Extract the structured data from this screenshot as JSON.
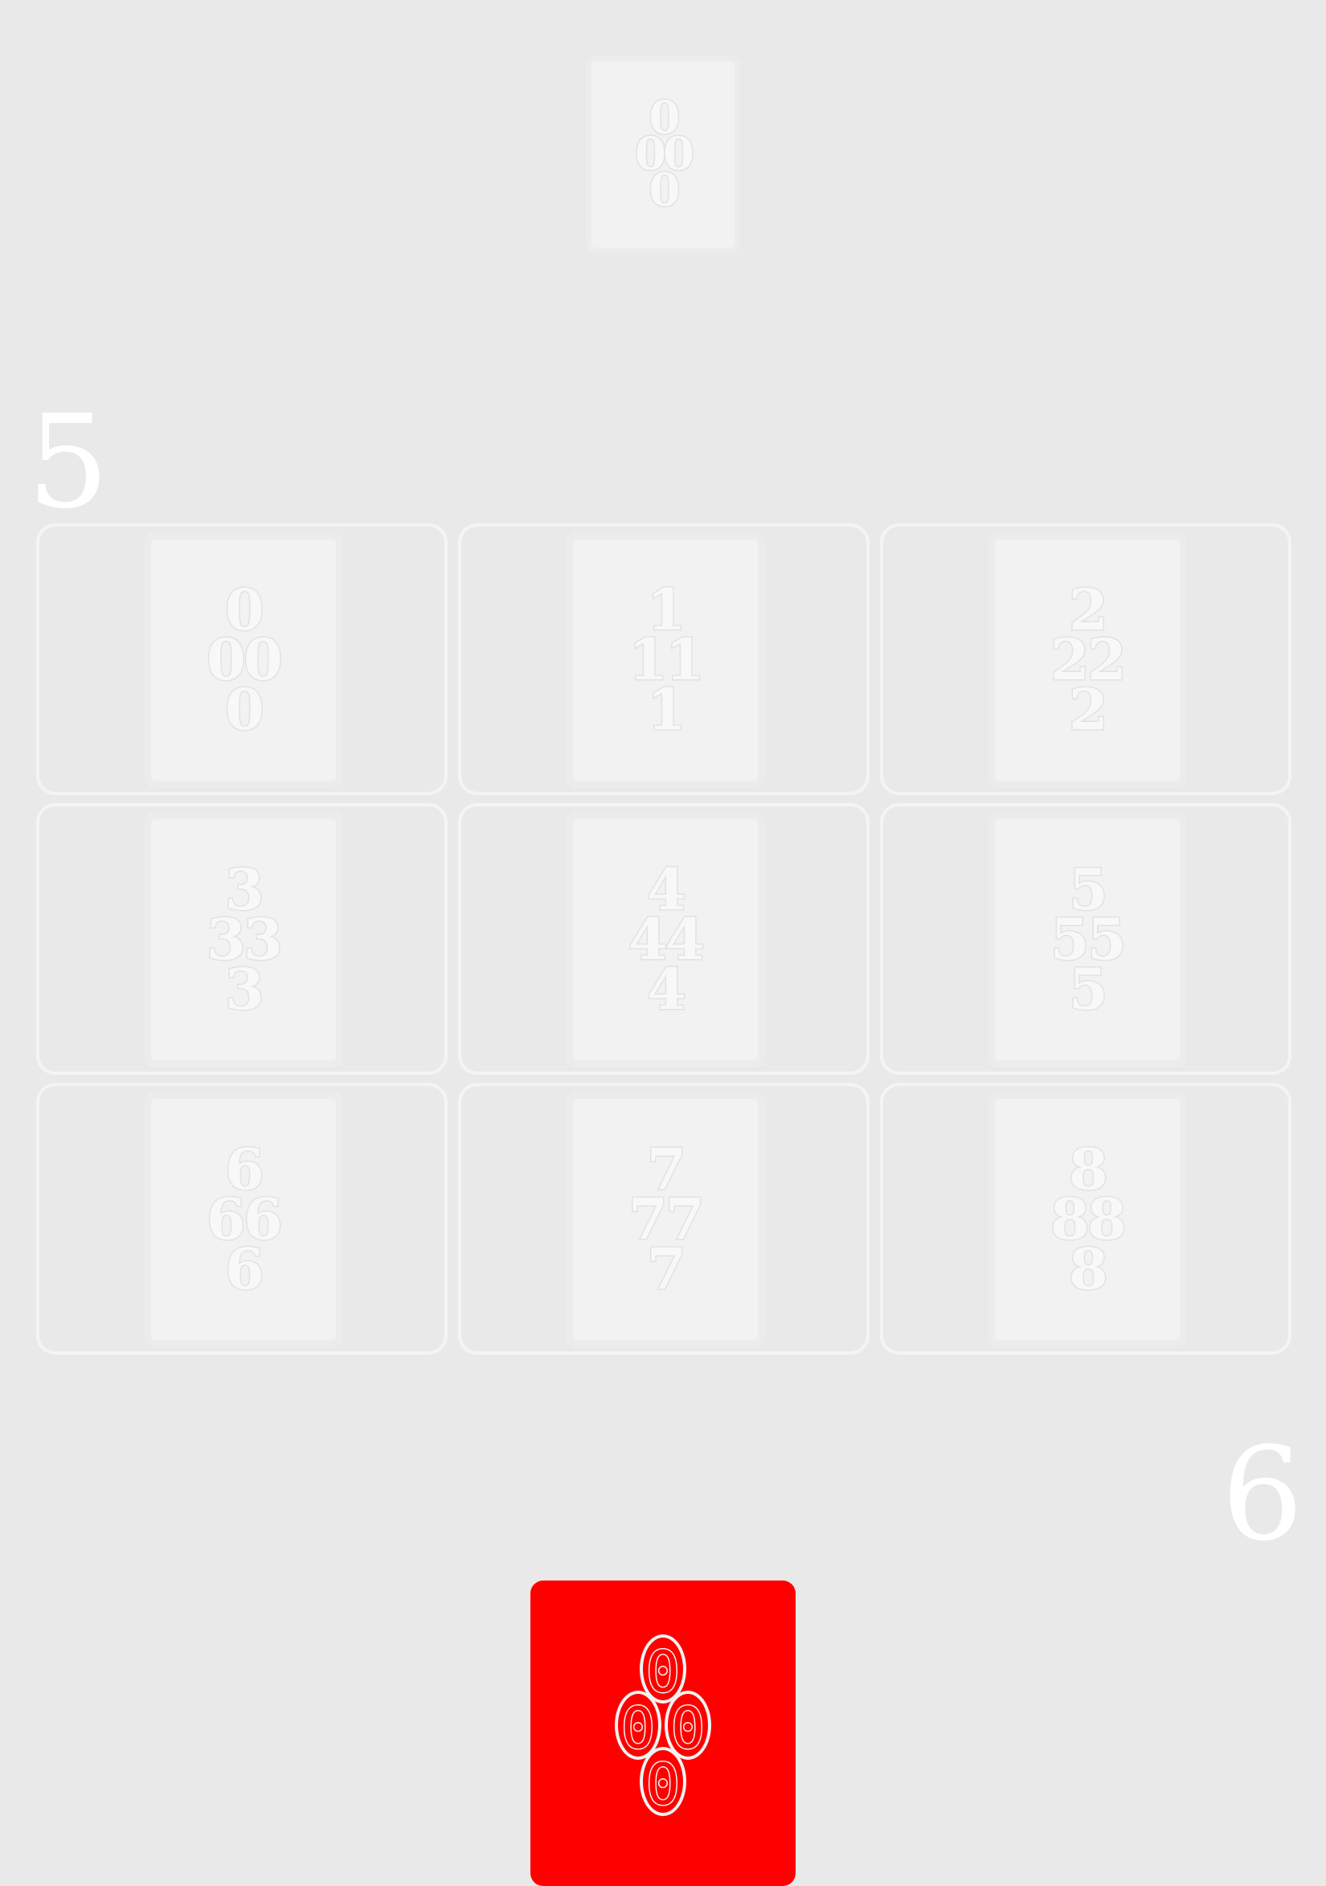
{
  "opponent": {
    "card_value": "0"
  },
  "scores": {
    "top": "5",
    "bottom": "6"
  },
  "board": {
    "cells": [
      {
        "value": "0"
      },
      {
        "value": "1"
      },
      {
        "value": "2"
      },
      {
        "value": "3"
      },
      {
        "value": "4"
      },
      {
        "value": "5"
      },
      {
        "value": "6"
      },
      {
        "value": "7"
      },
      {
        "value": "8"
      }
    ]
  },
  "player": {
    "card_value": "0",
    "card_color": "#ff0000"
  },
  "colors": {
    "background": "#e9e9e9",
    "card_face": "#f2f2f2",
    "cell_border": "#f4f4f4",
    "score_text": "#ffffff",
    "player_card": "#ff0000"
  }
}
